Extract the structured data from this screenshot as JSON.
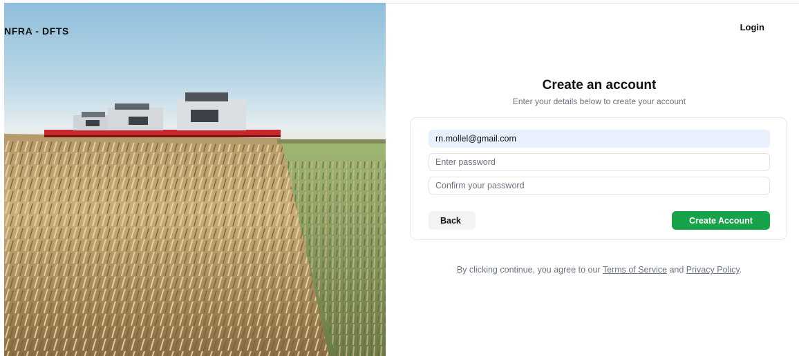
{
  "brand": {
    "title": "NFRA - DFTS"
  },
  "header": {
    "login_label": "Login"
  },
  "form": {
    "title": "Create an account",
    "subtitle": "Enter your details below to create your account",
    "email_value": "rn.mollel@gmail.com",
    "password_placeholder": "Enter password",
    "confirm_placeholder": "Confirm your password",
    "back_label": "Back",
    "create_label": "Create Account"
  },
  "legal": {
    "prefix": "By clicking continue, you agree to our",
    "terms_label": "Terms of Service",
    "conjunction": "and",
    "privacy_label": "Privacy Policy",
    "suffix": "."
  },
  "colors": {
    "primary_button": "#16a34a",
    "autofill_background": "#e8f0fe"
  }
}
